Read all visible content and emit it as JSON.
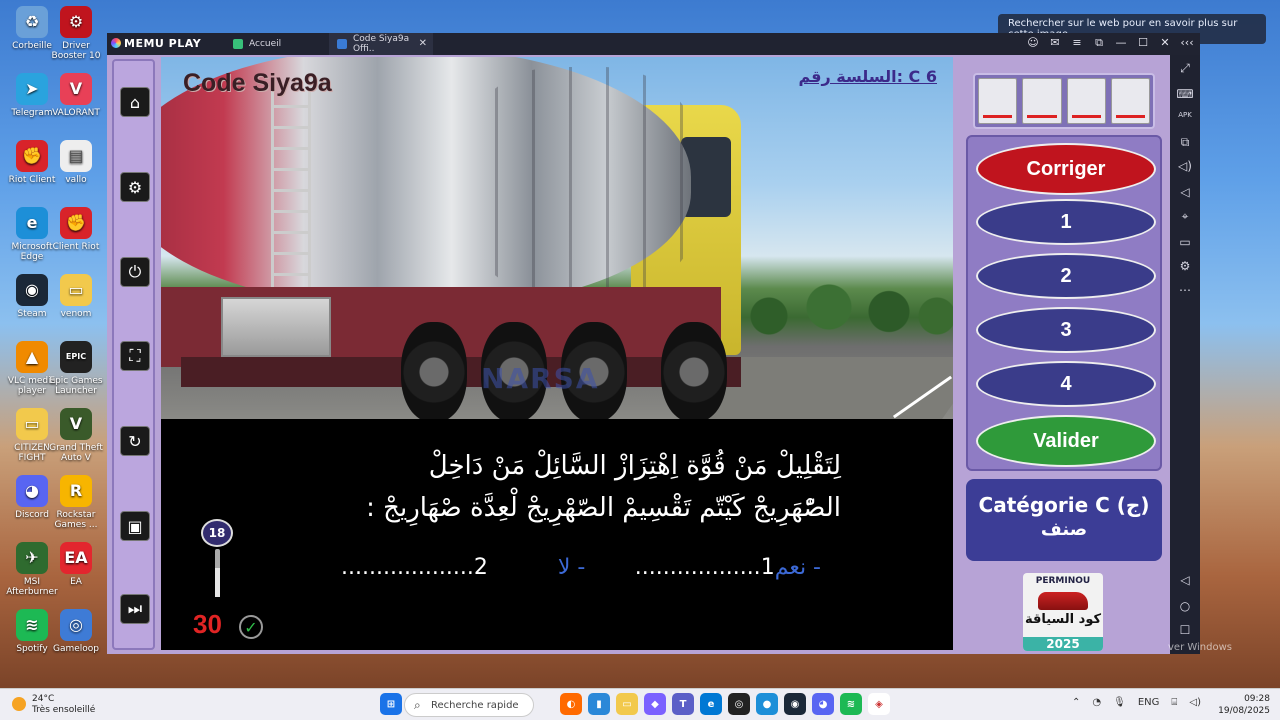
{
  "desktop": {
    "icons": [
      {
        "label": "Corbeille",
        "glyph": "♻",
        "color": "#6aa0d8"
      },
      {
        "label": "Driver Booster 10",
        "glyph": "⚙",
        "color": "#c0141e"
      },
      {
        "label": "Telegram",
        "glyph": "➤",
        "color": "#2aa3de"
      },
      {
        "label": "VALORANT",
        "glyph": "V",
        "color": "#e84057"
      },
      {
        "label": "Riot Client",
        "glyph": "✊",
        "color": "#d8232a"
      },
      {
        "label": "vallo",
        "glyph": "▤",
        "color": "#eeeeee"
      },
      {
        "label": "Microsoft Edge",
        "glyph": "e",
        "color": "#1d8fd8"
      },
      {
        "label": "Client Riot",
        "glyph": "✊",
        "color": "#d8232a"
      },
      {
        "label": "Steam",
        "glyph": "◉",
        "color": "#1b2838"
      },
      {
        "label": "venom",
        "glyph": "▭",
        "color": "#f2c94c"
      },
      {
        "label": "VLC media player",
        "glyph": "▲",
        "color": "#f08a00"
      },
      {
        "label": "Epic Games Launcher",
        "glyph": "EPIC",
        "color": "#222222"
      },
      {
        "label": "CITIZEN FIGHT",
        "glyph": "▭",
        "color": "#f2c94c"
      },
      {
        "label": "Grand Theft Auto V",
        "glyph": "V",
        "color": "#3a5a2a"
      },
      {
        "label": "Discord",
        "glyph": "◕",
        "color": "#5865f2"
      },
      {
        "label": "Rockstar Games ...",
        "glyph": "R",
        "color": "#f7b500"
      },
      {
        "label": "MSI Afterburner",
        "glyph": "✈",
        "color": "#2f6b2f"
      },
      {
        "label": "EA",
        "glyph": "EA",
        "color": "#e3262e"
      },
      {
        "label": "Spotify",
        "glyph": "≋",
        "color": "#1db954"
      },
      {
        "label": "Gameloop",
        "glyph": "◎",
        "color": "#3e7bd6"
      }
    ]
  },
  "search_tip": "Rechercher sur le web pour en savoir plus sur cette image",
  "window": {
    "brand": "MEMU PLAY",
    "tabs": [
      {
        "label": "Accueil",
        "color": "#38c07a"
      },
      {
        "label": "Code Siya9a Offi..",
        "color": "#3a7bd5"
      }
    ],
    "controls": [
      "☺",
      "✉",
      "≡",
      "⧉",
      "—",
      "☐",
      "✕",
      "‹‹‹"
    ],
    "rail": [
      "⤢",
      "⌨",
      "APK",
      "⧉",
      "◁)",
      "◁",
      "⌖",
      "▭",
      "⚙",
      "⋯",
      "◁",
      "○",
      "☐"
    ]
  },
  "app": {
    "title": "Code Siya9a",
    "series_label": "السلسة رقم: C 6",
    "watermark": "NARSA",
    "sidebar": [
      {
        "name": "home",
        "glyph": "⌂"
      },
      {
        "name": "settings",
        "glyph": "⚙"
      },
      {
        "name": "power",
        "glyph": "⏻"
      },
      {
        "name": "fullscreen",
        "glyph": "⛶"
      },
      {
        "name": "refresh",
        "glyph": "↻"
      },
      {
        "name": "profile",
        "glyph": "▣"
      },
      {
        "name": "skip",
        "glyph": "⏭"
      }
    ],
    "question": {
      "line1": "لِتَقْلِيلْ مَنْ قُوَّة اِهْتِزَازْ السَّائِلْ مَنْ دَاخِلْ",
      "line2": "الصّْهَرِيجْ كَيْتّم تَقْسِيمْ الصّهْرِيجْ لْعِدَّة صْهَارِيجْ :",
      "answer_yes_label": "- نعم",
      "answer_yes_dots": "1..................",
      "answer_no_label": "- لا",
      "answer_no_dots": "2..................."
    },
    "timer": {
      "badge": "18",
      "count": "30",
      "progress": 0.6
    },
    "answer_slots": 4,
    "buttons": {
      "corriger": "Corriger",
      "opt1": "1",
      "opt2": "2",
      "opt3": "3",
      "opt4": "4",
      "valider": "Valider"
    },
    "category_line1": "Catégorie C (ج)",
    "category_line2": "صنف",
    "promo": {
      "brand": "PERMINOU",
      "text": "كود السياقة",
      "year": "2025"
    }
  },
  "os_watermark": "ver Windows",
  "taskbar": {
    "weather_temp": "24°C",
    "weather_desc": "Très ensoleillé",
    "search_placeholder": "Recherche rapide",
    "lang": "ENG",
    "time": "09:28",
    "date": "19/08/2025"
  }
}
